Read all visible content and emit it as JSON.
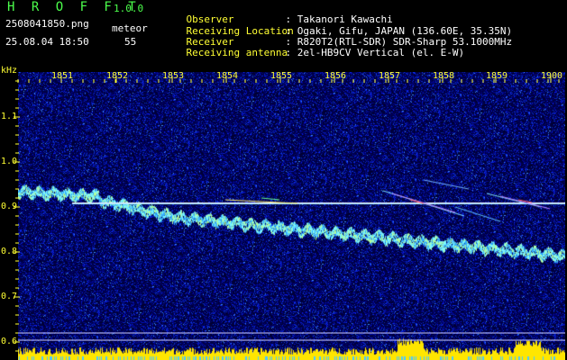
{
  "header": {
    "app_name": "H R O F F T",
    "app_version": "1.0.0",
    "filename": "2508041850.png",
    "meteor_label": "meteor",
    "datetime": "25.08.04 18:50",
    "meteor_count": "55"
  },
  "info": [
    {
      "label": "Observer",
      "value": ": Takanori Kawachi"
    },
    {
      "label": "Receiving Location",
      "value": ": Ogaki, Gifu, JAPAN (136.60E, 35.35N)"
    },
    {
      "label": "Receiver",
      "value": ": R820T2(RTL-SDR) SDR-Sharp 53.1000MHz"
    },
    {
      "label": "Receiving antenna",
      "value": ": 2el-HB9CV Vertical (el. E-W)"
    }
  ],
  "axis": {
    "y_unit": "kHz",
    "y_ticks": [
      "1.1",
      "1.0",
      "0.9",
      "0.8",
      "0.7",
      "0.6"
    ],
    "x_ticks": [
      "1851",
      "1852",
      "1853",
      "1854",
      "1855",
      "1856",
      "1857",
      "1858",
      "1859",
      "1900"
    ]
  },
  "colors": {
    "background": "#000033",
    "noise": "#1a2fd0",
    "trace": "#38d8ff",
    "line": "#f0f0ff",
    "label": "#ffff33",
    "bottom_band": "#ffe600"
  }
}
